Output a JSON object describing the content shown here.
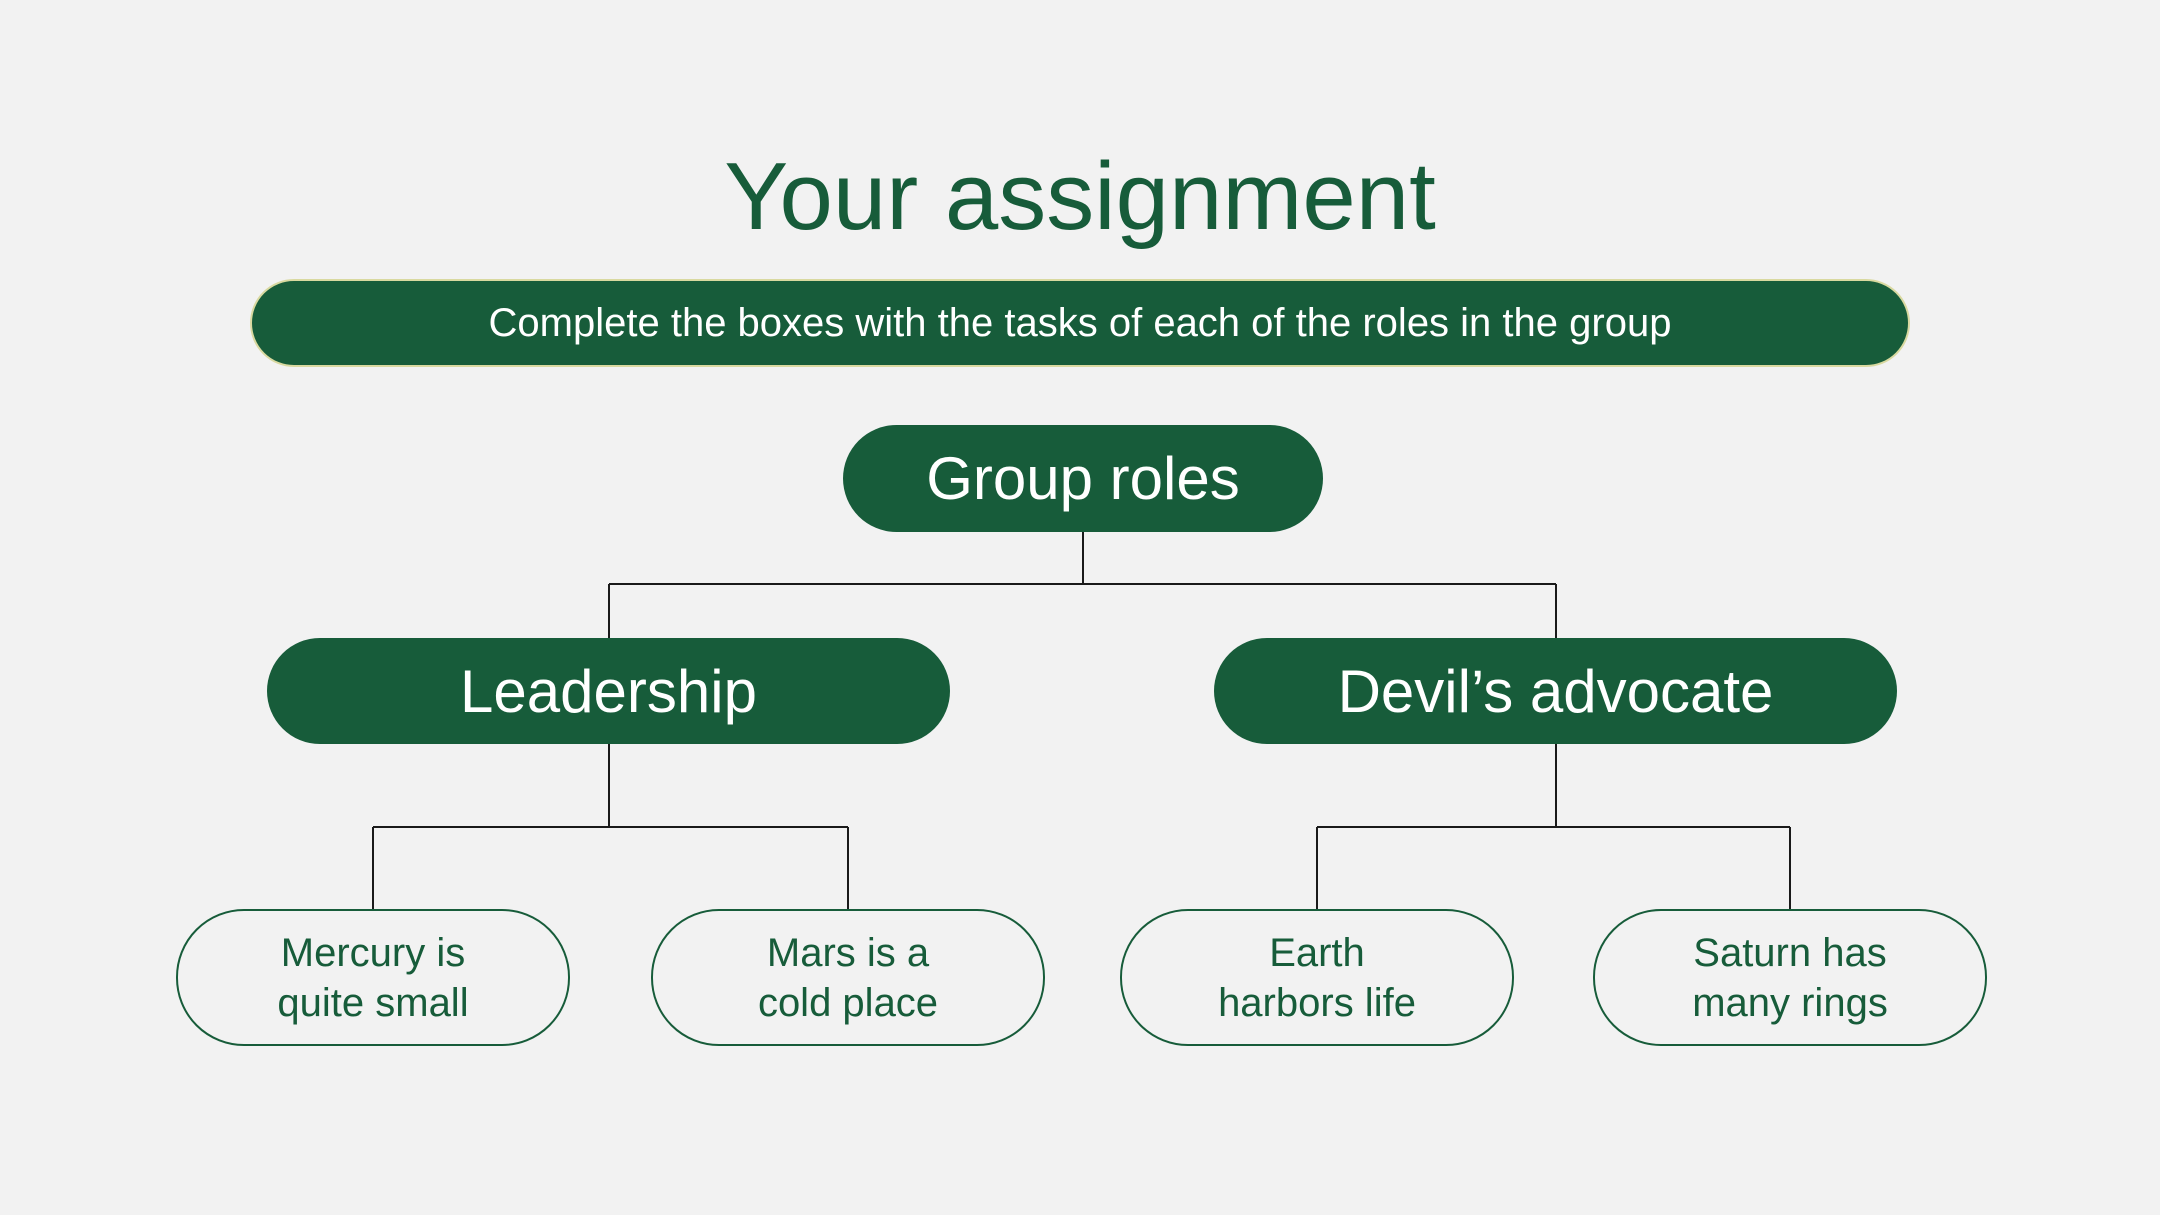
{
  "title": "Your assignment",
  "instruction": "Complete the boxes with the tasks of each of the roles in the group",
  "root": {
    "label": "Group roles"
  },
  "roles": [
    {
      "label": "Leadership",
      "tasks": [
        "Mercury is\nquite small",
        "Mars is a\ncold place"
      ]
    },
    {
      "label": "Devil’s advocate",
      "tasks": [
        "Earth\nharbors life",
        "Saturn has\nmany rings"
      ]
    }
  ],
  "colors": {
    "accent": "#175c3a",
    "background": "#f2f2f2",
    "banner_border": "#d9d9a0",
    "connector": "#1a1a1a"
  }
}
